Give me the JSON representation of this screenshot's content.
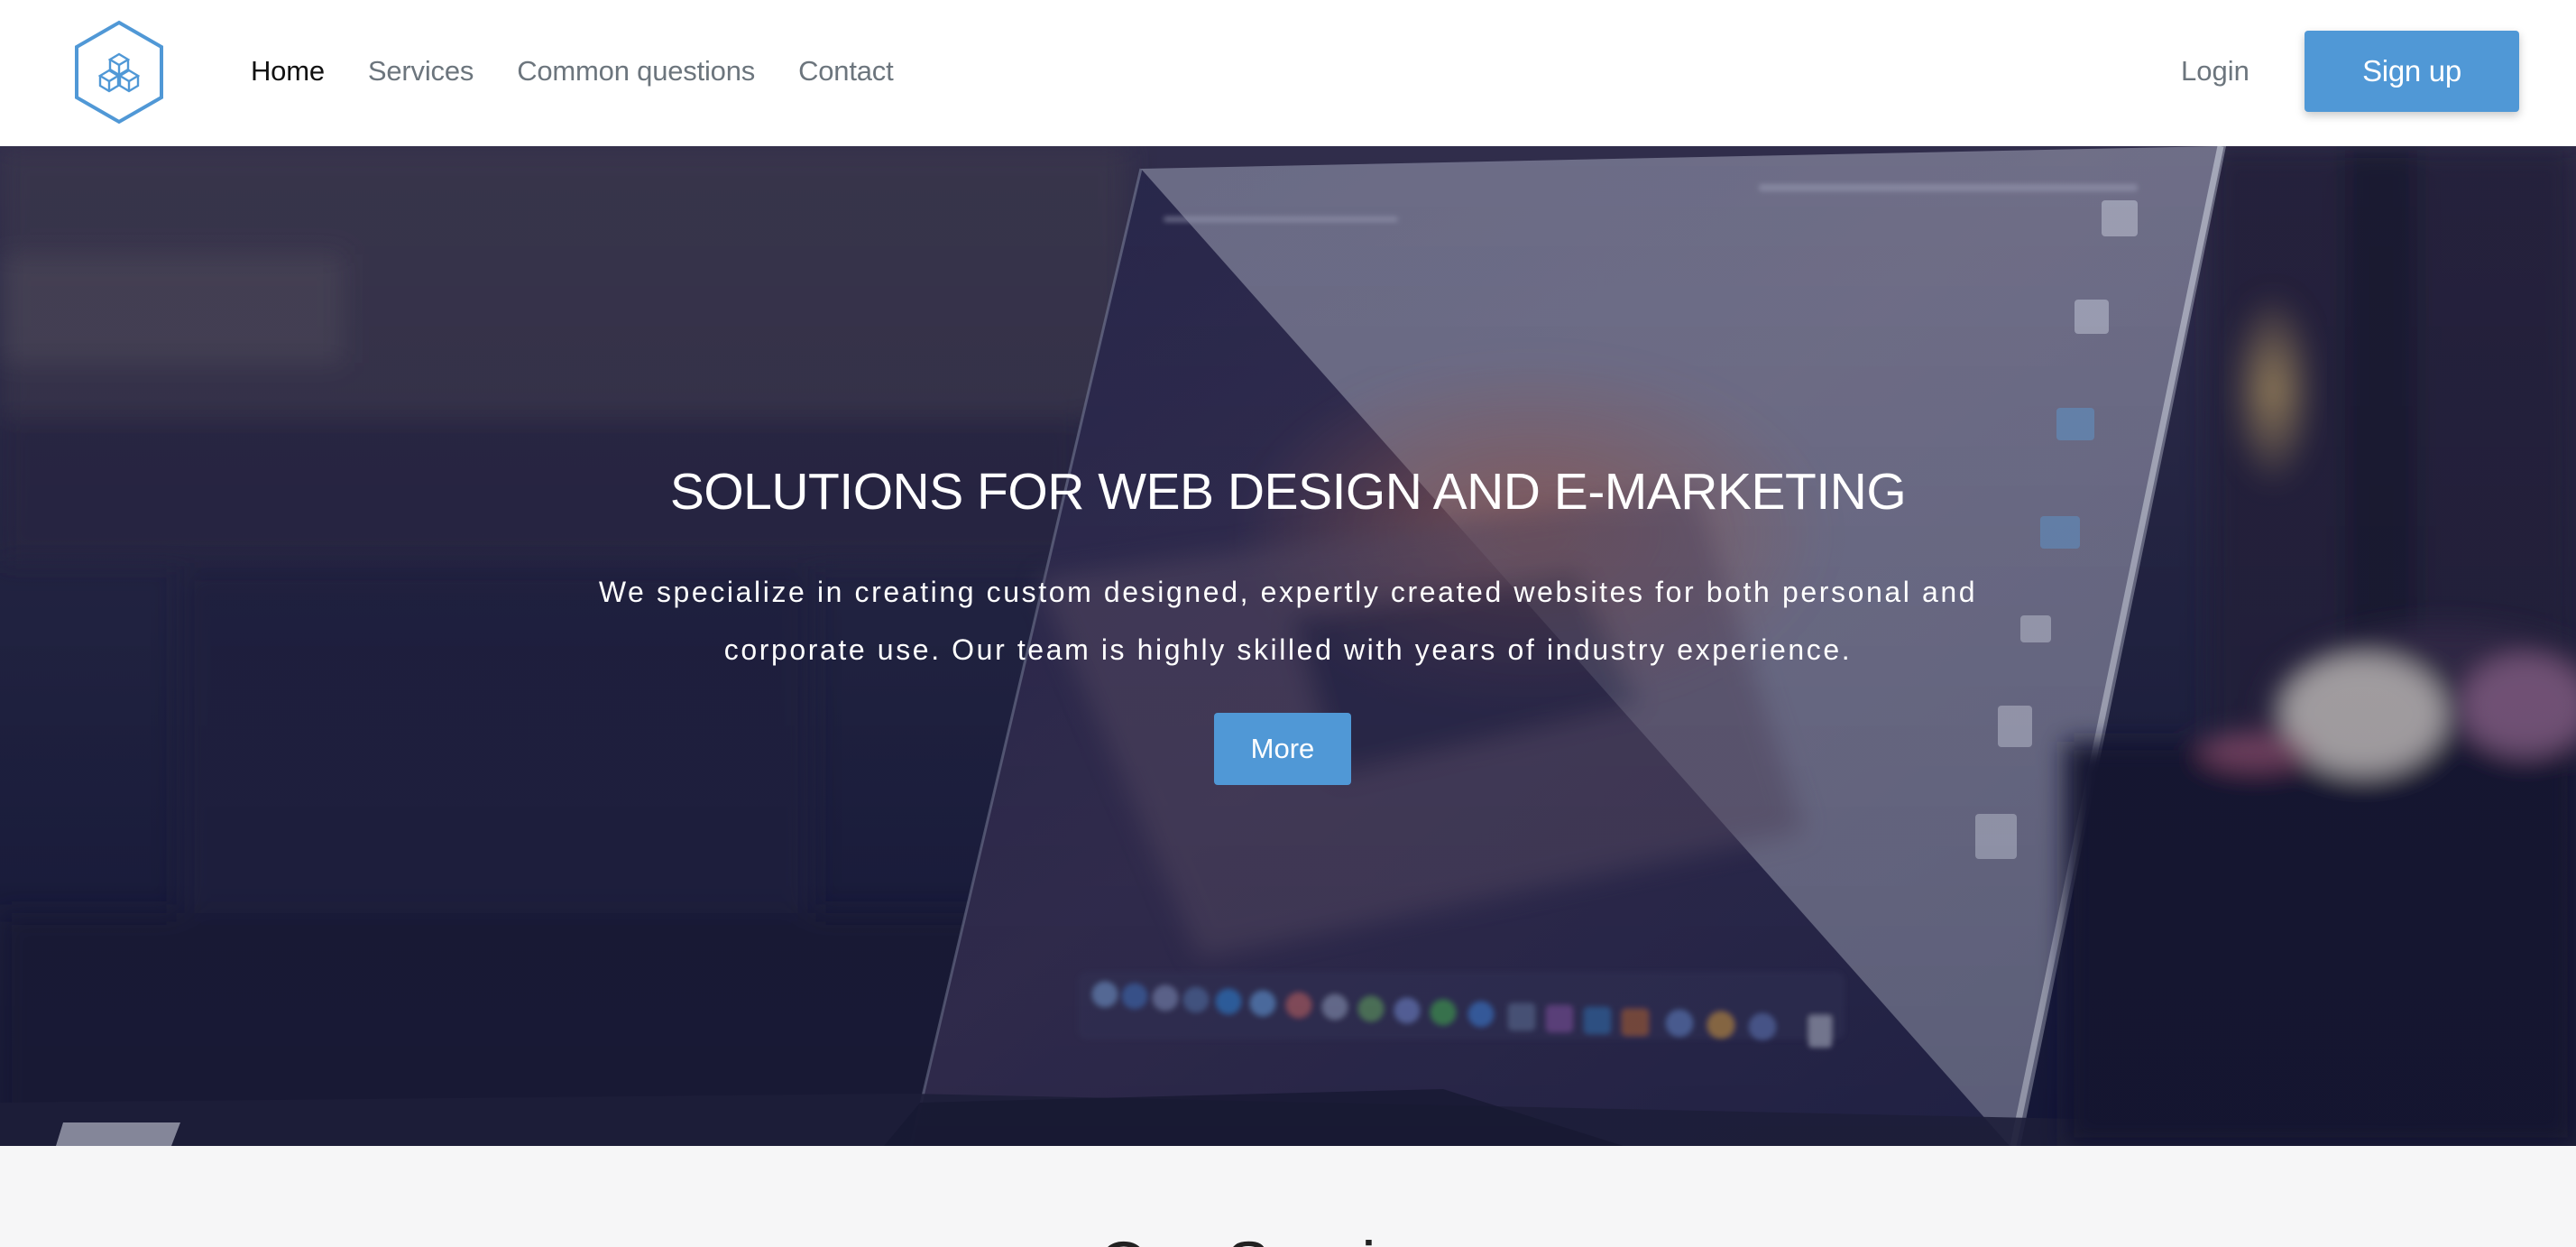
{
  "nav": {
    "logo_icon": "cubes-hexagon-icon",
    "links": [
      "Home",
      "Services",
      "Common questions",
      "Contact"
    ],
    "active_link": "Home",
    "login_label": "Login",
    "signup_label": "Sign up"
  },
  "hero": {
    "title": "SOLUTIONS FOR WEB DESIGN AND E-MARKETING",
    "description": "We specialize in creating custom designed, expertly created websites for both personal and corporate use. Our team is highly skilled with years of industry experience.",
    "button_label": "More",
    "background_image": "laptop-on-desk-photo"
  },
  "services": {
    "title": "Our Services"
  },
  "colors": {
    "accent": "#5098d6",
    "nav_text": "#6c757d",
    "nav_active": "#111111",
    "section_bg": "#f6f6f7"
  }
}
